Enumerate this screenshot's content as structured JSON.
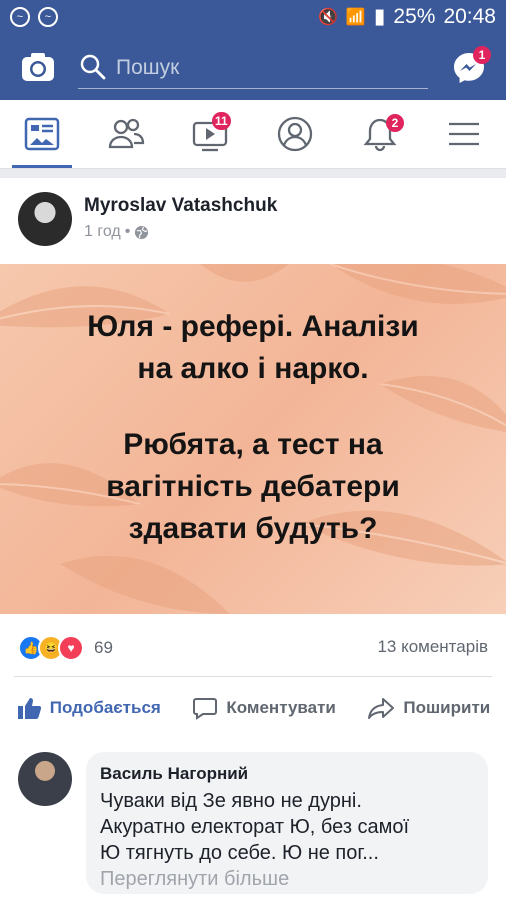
{
  "status_bar": {
    "battery": "25%",
    "time": "20:48"
  },
  "top_bar": {
    "search_placeholder": "Пошук",
    "messenger_badge": "1"
  },
  "nav": {
    "video_badge": "11",
    "notifications_badge": "2"
  },
  "post": {
    "author": "Myroslav Vatashchuk",
    "time": "1 год",
    "image_text": {
      "line1": "Юля - рефері. Аналізи",
      "line2": "на алко і нарко.",
      "line3": "Рюбята, а тест на",
      "line4": "вагітність дебатери",
      "line5": "здавати будуть?"
    },
    "reactions_count": "69",
    "comments_count": "13 коментарів",
    "actions": {
      "like": "Подобається",
      "comment": "Коментувати",
      "share": "Поширити"
    }
  },
  "comment": {
    "name": "Василь Нагорний",
    "line1": "Чуваки від Зе  явно не дурні.",
    "line2": "Акуратно електорат Ю, без самої",
    "line3": "Ю  тягнуть до себе. Ю не пог...",
    "more": "Переглянути більше"
  }
}
